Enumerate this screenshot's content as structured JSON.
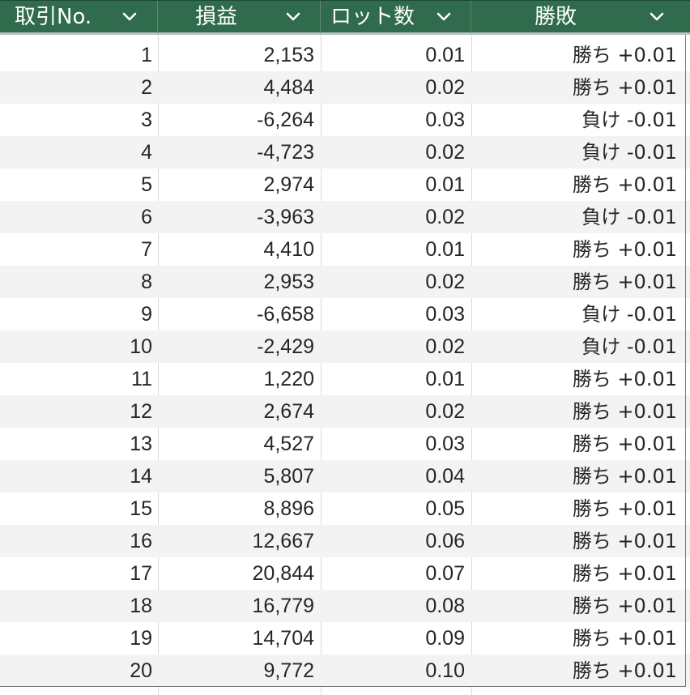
{
  "columns": [
    {
      "label": "取引No."
    },
    {
      "label": "損益"
    },
    {
      "label": "ロット数"
    },
    {
      "label": "勝敗"
    }
  ],
  "rows": [
    {
      "no": "1",
      "pl": "2,153",
      "lot": "0.01",
      "wl": "勝ち +0.01"
    },
    {
      "no": "2",
      "pl": "4,484",
      "lot": "0.02",
      "wl": "勝ち +0.01"
    },
    {
      "no": "3",
      "pl": "-6,264",
      "lot": "0.03",
      "wl": "負け -0.01"
    },
    {
      "no": "4",
      "pl": "-4,723",
      "lot": "0.02",
      "wl": "負け -0.01"
    },
    {
      "no": "5",
      "pl": "2,974",
      "lot": "0.01",
      "wl": "勝ち +0.01"
    },
    {
      "no": "6",
      "pl": "-3,963",
      "lot": "0.02",
      "wl": "負け -0.01"
    },
    {
      "no": "7",
      "pl": "4,410",
      "lot": "0.01",
      "wl": "勝ち +0.01"
    },
    {
      "no": "8",
      "pl": "2,953",
      "lot": "0.02",
      "wl": "勝ち +0.01"
    },
    {
      "no": "9",
      "pl": "-6,658",
      "lot": "0.03",
      "wl": "負け -0.01"
    },
    {
      "no": "10",
      "pl": "-2,429",
      "lot": "0.02",
      "wl": "負け -0.01"
    },
    {
      "no": "11",
      "pl": "1,220",
      "lot": "0.01",
      "wl": "勝ち +0.01"
    },
    {
      "no": "12",
      "pl": "2,674",
      "lot": "0.02",
      "wl": "勝ち +0.01"
    },
    {
      "no": "13",
      "pl": "4,527",
      "lot": "0.03",
      "wl": "勝ち +0.01"
    },
    {
      "no": "14",
      "pl": "5,807",
      "lot": "0.04",
      "wl": "勝ち +0.01"
    },
    {
      "no": "15",
      "pl": "8,896",
      "lot": "0.05",
      "wl": "勝ち +0.01"
    },
    {
      "no": "16",
      "pl": "12,667",
      "lot": "0.06",
      "wl": "勝ち +0.01"
    },
    {
      "no": "17",
      "pl": "20,844",
      "lot": "0.07",
      "wl": "勝ち +0.01"
    },
    {
      "no": "18",
      "pl": "16,779",
      "lot": "0.08",
      "wl": "勝ち +0.01"
    },
    {
      "no": "19",
      "pl": "14,704",
      "lot": "0.09",
      "wl": "勝ち +0.01"
    },
    {
      "no": "20",
      "pl": "9,772",
      "lot": "0.10",
      "wl": "勝ち +0.01"
    }
  ],
  "icons": {
    "filter": "chevron-down-icon"
  },
  "colors": {
    "header_bg": "#2f6b4c",
    "header_text": "#ffffff",
    "stripe": "#f3f3f3",
    "text": "#262626"
  }
}
